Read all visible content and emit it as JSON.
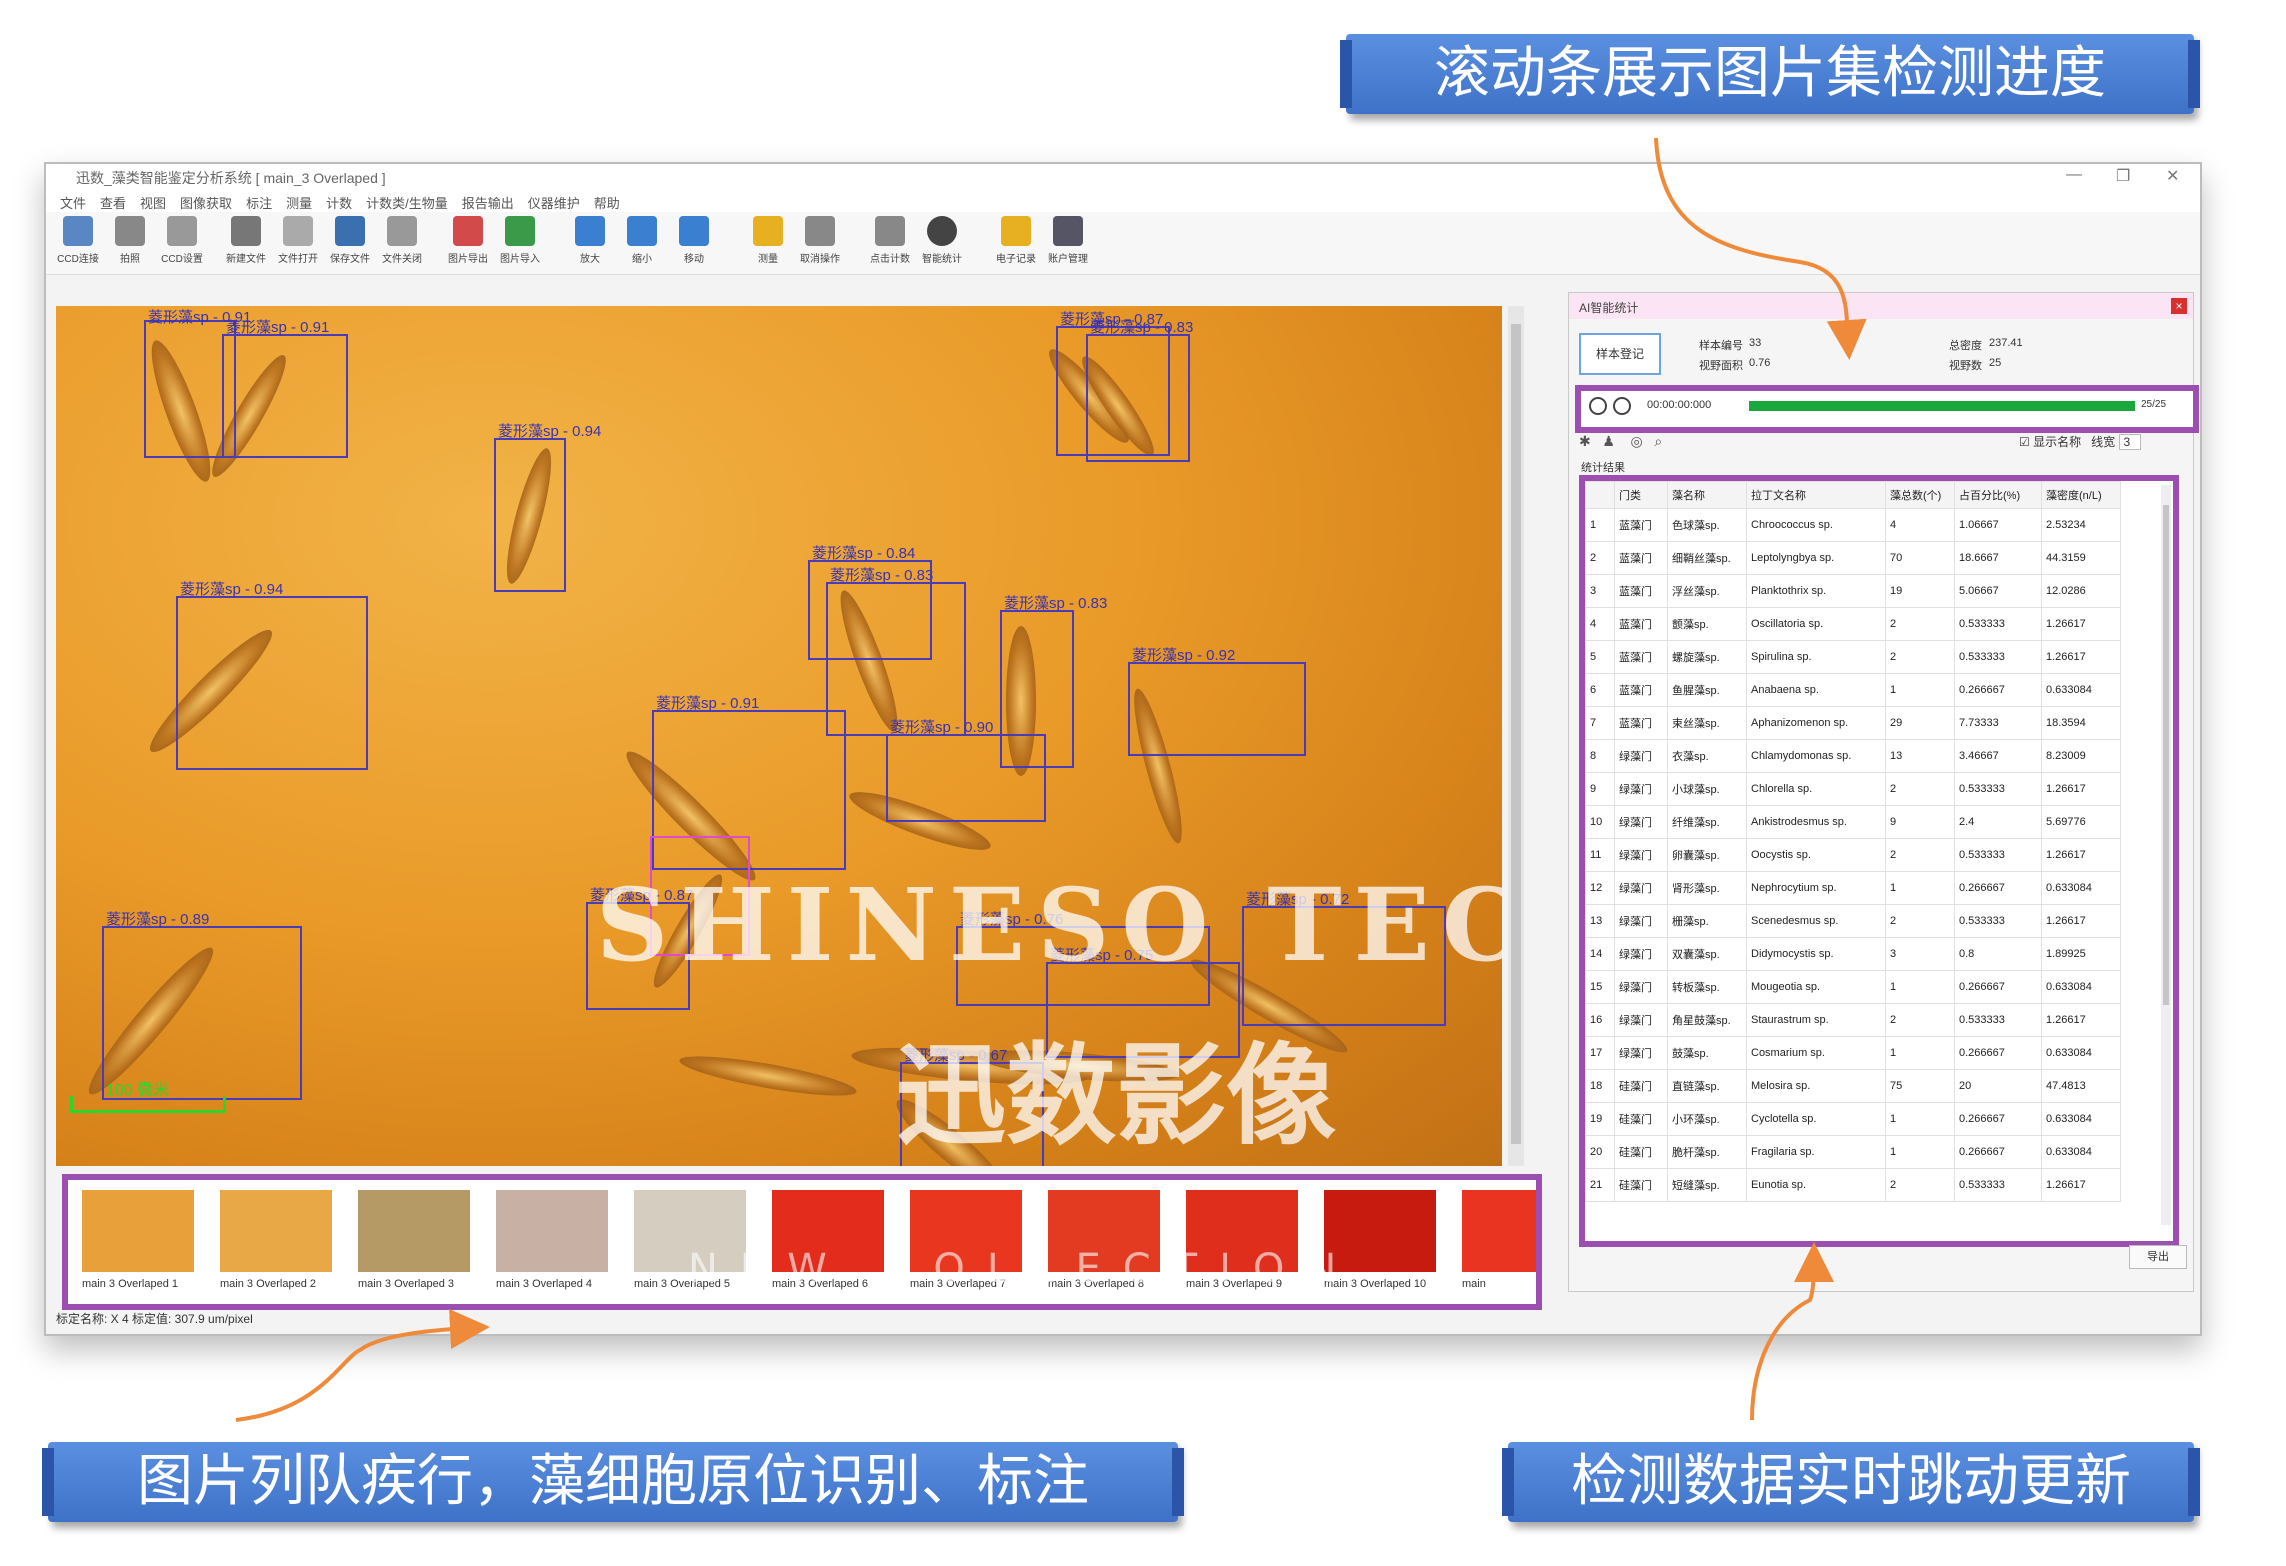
{
  "callouts": {
    "top": "滚动条展示图片集检测进度",
    "bottom_left": "图片列队疾行，藻细胞原位识别、标注",
    "bottom_right": "检测数据实时跳动更新"
  },
  "window": {
    "title": "迅数_藻类智能鉴定分析系统 [ main_3 Overlaped ]",
    "menu": [
      "文件",
      "查看",
      "视图",
      "图像获取",
      "标注",
      "测量",
      "计数",
      "计数类/生物量",
      "报告输出",
      "仪器维护",
      "帮助"
    ],
    "toolbar": [
      "CCD连接",
      "拍照",
      "CCD设置",
      "新建文件",
      "文件打开",
      "保存文件",
      "文件关闭",
      "图片导出",
      "图片导入",
      "放大",
      "缩小",
      "移动",
      "测量",
      "取消操作",
      "点击计数",
      "智能统计",
      "电子记录",
      "账户管理"
    ]
  },
  "image": {
    "detections": [
      "菱形藻sp - 0.91",
      "菱形藻sp - 0.94",
      "菱形藻sp - 0.94",
      "菱形藻sp - 0.87",
      "菱形藻sp - 0.83",
      "菱形藻sp - 0.83",
      "菱形藻sp - 0.84",
      "菱形藻sp - 0.92",
      "菱形藻sp - 0.83",
      "菱形藻sp - 0.91",
      "菱形藻sp - 0.90",
      "菱形藻sp - 0.89",
      "菱形藻sp - 0.87",
      "菱形藻sp - 0.76",
      "菱形藻sp - 0.75",
      "菱形藻sp - 0.72",
      "菱形藻sp - 0.67",
      "菱形藻sp - 0.81"
    ],
    "scale_label": "100 微米",
    "watermark_en": "SHINESO TEC",
    "watermark_cn": "迅数影像"
  },
  "thumbnails": [
    {
      "caption": "main 3 Overlaped 1",
      "color": "#e8a03a"
    },
    {
      "caption": "main 3 Overlaped 2",
      "color": "#e8a845"
    },
    {
      "caption": "main 3 Overlaped 3",
      "color": "#b59a66"
    },
    {
      "caption": "main 3 Overlaped 4",
      "color": "#c8b0a4"
    },
    {
      "caption": "main 3 Overlaped 5",
      "color": "#d4cdc0"
    },
    {
      "caption": "main 3 Overlaped 6",
      "color": "#e42c1c"
    },
    {
      "caption": "main 3 Overlaped 7",
      "color": "#e8361f"
    },
    {
      "caption": "main 3 Overlaped 8",
      "color": "#e33a22"
    },
    {
      "caption": "main 3 Overlaped 9",
      "color": "#e02e1c"
    },
    {
      "caption": "main 3 Overlaped 10",
      "color": "#c81b10"
    },
    {
      "caption": "main",
      "color": "#e83421"
    }
  ],
  "thumb_watermark": "NEW COLLECTION",
  "statusbar": "标定名称: X 4    标定值: 307.9 um/pixel",
  "panel": {
    "title": "AI智能统计",
    "register_button": "样本登记",
    "sample_no_label": "样本编号",
    "sample_no": "33",
    "total_label": "总密度",
    "total": "237.41",
    "area_label": "视野面积",
    "area": "0.76",
    "fields_label": "视野数",
    "fields": "25",
    "timer": "00:00:00:000",
    "progress": {
      "current": 25,
      "total": 25,
      "text": "25/25",
      "fraction": 1.0
    },
    "show_name_label": "显示名称",
    "line_width_label": "线宽",
    "line_width": "3",
    "stats_label": "统计结果",
    "export_button": "导出",
    "table": {
      "headers": [
        "",
        "门类",
        "藻名称",
        "拉丁文名称",
        "藻总数(个)",
        "占百分比(%)",
        "藻密度(n/L)"
      ],
      "rows": [
        [
          "1",
          "蓝藻门",
          "色球藻sp.",
          "Chroococcus sp.",
          "4",
          "1.06667",
          "2.53234"
        ],
        [
          "2",
          "蓝藻门",
          "细鞘丝藻sp.",
          "Leptolyngbya sp.",
          "70",
          "18.6667",
          "44.3159"
        ],
        [
          "3",
          "蓝藻门",
          "浮丝藻sp.",
          "Planktothrix sp.",
          "19",
          "5.06667",
          "12.0286"
        ],
        [
          "4",
          "蓝藻门",
          "颤藻sp.",
          "Oscillatoria sp.",
          "2",
          "0.533333",
          "1.26617"
        ],
        [
          "5",
          "蓝藻门",
          "螺旋藻sp.",
          "Spirulina sp.",
          "2",
          "0.533333",
          "1.26617"
        ],
        [
          "6",
          "蓝藻门",
          "鱼腥藻sp.",
          "Anabaena sp.",
          "1",
          "0.266667",
          "0.633084"
        ],
        [
          "7",
          "蓝藻门",
          "束丝藻sp.",
          "Aphanizomenon sp.",
          "29",
          "7.73333",
          "18.3594"
        ],
        [
          "8",
          "绿藻门",
          "衣藻sp.",
          "Chlamydomonas sp.",
          "13",
          "3.46667",
          "8.23009"
        ],
        [
          "9",
          "绿藻门",
          "小球藻sp.",
          "Chlorella sp.",
          "2",
          "0.533333",
          "1.26617"
        ],
        [
          "10",
          "绿藻门",
          "纤维藻sp.",
          "Ankistrodesmus sp.",
          "9",
          "2.4",
          "5.69776"
        ],
        [
          "11",
          "绿藻门",
          "卵囊藻sp.",
          "Oocystis sp.",
          "2",
          "0.533333",
          "1.26617"
        ],
        [
          "12",
          "绿藻门",
          "肾形藻sp.",
          "Nephrocytium sp.",
          "1",
          "0.266667",
          "0.633084"
        ],
        [
          "13",
          "绿藻门",
          "栅藻sp.",
          "Scenedesmus sp.",
          "2",
          "0.533333",
          "1.26617"
        ],
        [
          "14",
          "绿藻门",
          "双囊藻sp.",
          "Didymocystis sp.",
          "3",
          "0.8",
          "1.89925"
        ],
        [
          "15",
          "绿藻门",
          "转板藻sp.",
          "Mougeotia sp.",
          "1",
          "0.266667",
          "0.633084"
        ],
        [
          "16",
          "绿藻门",
          "角星鼓藻sp.",
          "Staurastrum sp.",
          "2",
          "0.533333",
          "1.26617"
        ],
        [
          "17",
          "绿藻门",
          "鼓藻sp.",
          "Cosmarium sp.",
          "1",
          "0.266667",
          "0.633084"
        ],
        [
          "18",
          "硅藻门",
          "直链藻sp.",
          "Melosira sp.",
          "75",
          "20",
          "47.4813"
        ],
        [
          "19",
          "硅藻门",
          "小环藻sp.",
          "Cyclotella sp.",
          "1",
          "0.266667",
          "0.633084"
        ],
        [
          "20",
          "硅藻门",
          "脆杆藻sp.",
          "Fragilaria sp.",
          "1",
          "0.266667",
          "0.633084"
        ],
        [
          "21",
          "硅藻门",
          "短缝藻sp.",
          "Eunotia sp.",
          "2",
          "0.533333",
          "1.26617"
        ]
      ]
    }
  },
  "colors": {
    "accent_purple": "#9b4fb0",
    "progress_green": "#1aa83c",
    "banner_blue": "#4a80d6",
    "arrow_orange": "#ee8a3a"
  }
}
